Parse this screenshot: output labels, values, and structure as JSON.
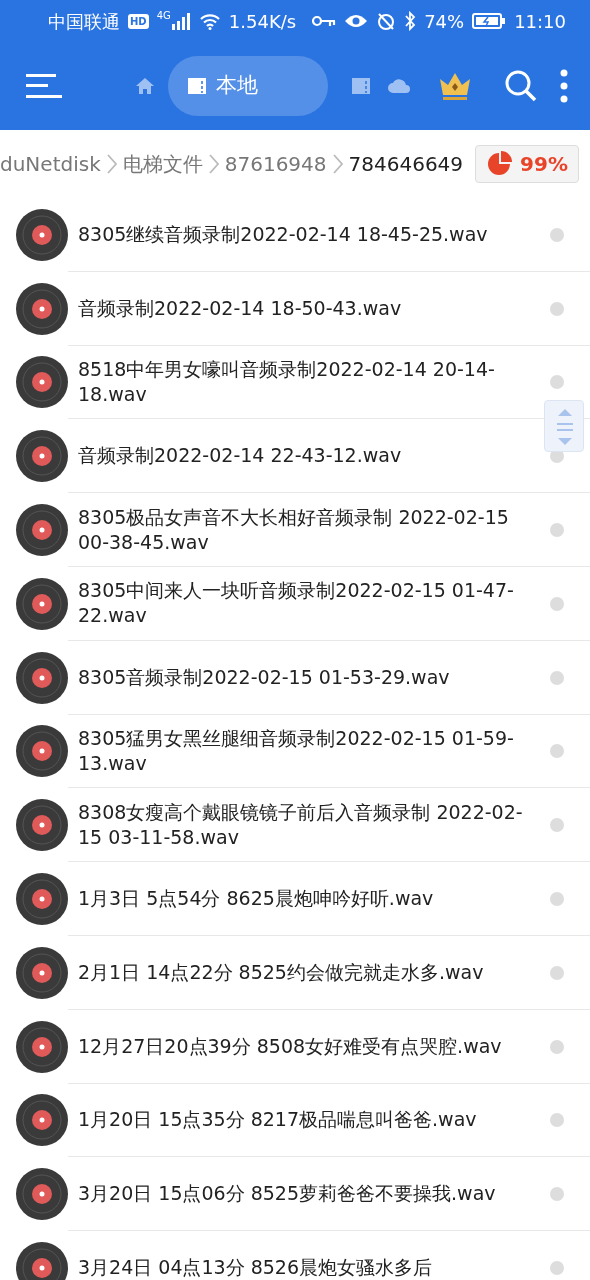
{
  "status_bar": {
    "carrier": "中国联通",
    "hd": "HD",
    "network": "4G",
    "speed": "1.54K/s",
    "battery": "74%",
    "time": "11:10"
  },
  "toolbar": {
    "tabs": [
      {
        "kind": "home",
        "selected": false
      },
      {
        "kind": "local",
        "label": "本地",
        "selected": true
      },
      {
        "kind": "sd",
        "selected": false
      },
      {
        "kind": "cloud",
        "selected": false
      }
    ]
  },
  "breadcrumb": [
    "duNetdisk",
    "电梯文件",
    "87616948",
    "784646649"
  ],
  "storage": {
    "reading": "99%"
  },
  "files": [
    {
      "name": "8305继续音频录制2022-02-14 18-45-25.wav",
      "selected": false
    },
    {
      "name": "音频录制2022-02-14 18-50-43.wav",
      "selected": false
    },
    {
      "name": "8518中年男女嚎叫音频录制2022-02-14 20-14-18.wav",
      "selected": false
    },
    {
      "name": "音频录制2022-02-14 22-43-12.wav",
      "selected": false
    },
    {
      "name": "8305极品女声音不大长相好音频录制 2022-02-15 00-38-45.wav",
      "selected": false
    },
    {
      "name": "8305中间来人一块听音频录制2022-02-15 01-47-22.wav",
      "selected": false
    },
    {
      "name": "8305音频录制2022-02-15 01-53-29.wav",
      "selected": false
    },
    {
      "name": "8305猛男女黑丝腿细音频录制2022-02-15 01-59-13.wav",
      "selected": false
    },
    {
      "name": "8308女瘦高个戴眼镜镜子前后入音频录制 2022-02-15 03-11-58.wav",
      "selected": false
    },
    {
      "name": "1月3日 5点54分 8625晨炮呻吟好听.wav",
      "selected": false
    },
    {
      "name": "2月1日 14点22分 8525约会做完就走水多.wav",
      "selected": false
    },
    {
      "name": "12月27日20点39分 8508女好难受有点哭腔.wav",
      "selected": false
    },
    {
      "name": "1月20日 15点35分 8217极品喘息叫爸爸.wav",
      "selected": false
    },
    {
      "name": "3月20日 15点06分 8525萝莉爸爸不要操我.wav",
      "selected": false
    },
    {
      "name": "3月24日 04点13分 8526晨炮女骚水多后",
      "selected": false
    }
  ]
}
